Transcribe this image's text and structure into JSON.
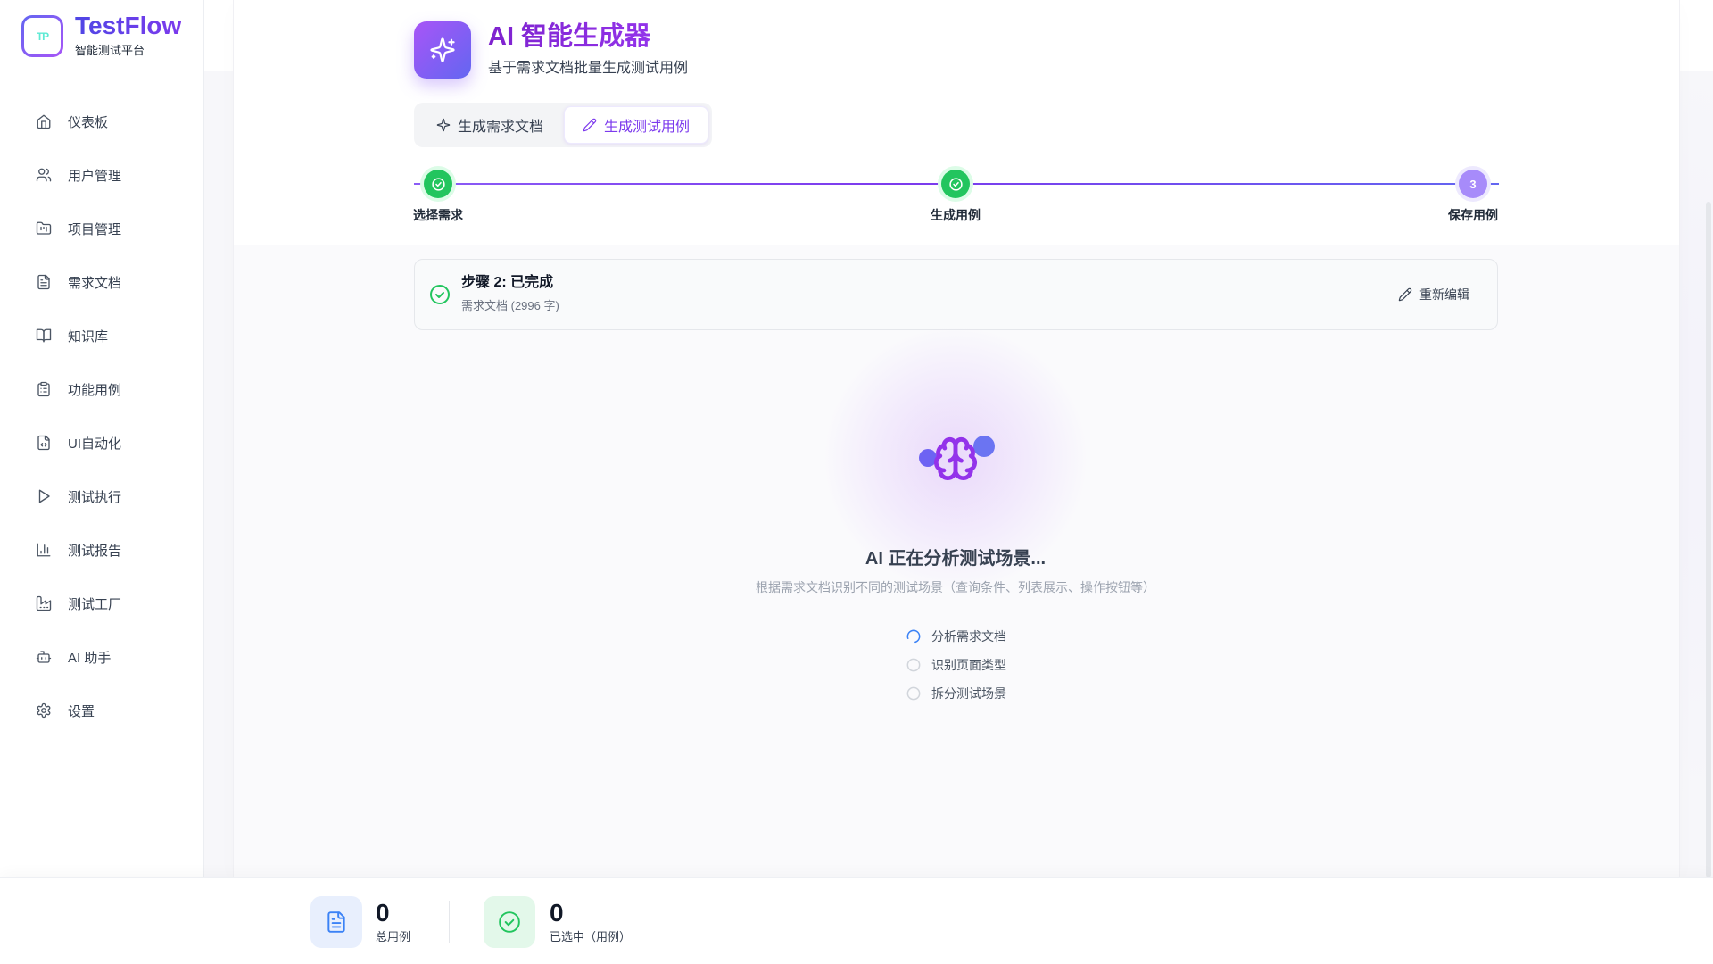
{
  "app": {
    "name": "TestFlow",
    "subtitle": "智能测试平台",
    "logo_text": "TP"
  },
  "sidebar": {
    "items": [
      {
        "label": "仪表板",
        "icon": "home-icon"
      },
      {
        "label": "用户管理",
        "icon": "users-icon"
      },
      {
        "label": "项目管理",
        "icon": "folder-icon"
      },
      {
        "label": "需求文档",
        "icon": "file-text-icon"
      },
      {
        "label": "知识库",
        "icon": "book-open-icon"
      },
      {
        "label": "功能用例",
        "icon": "clipboard-list-icon"
      },
      {
        "label": "UI自动化",
        "icon": "file-code-icon"
      },
      {
        "label": "测试执行",
        "icon": "play-icon"
      },
      {
        "label": "测试报告",
        "icon": "bar-chart-icon"
      },
      {
        "label": "测试工厂",
        "icon": "factory-icon"
      },
      {
        "label": "AI 助手",
        "icon": "bot-icon"
      },
      {
        "label": "设置",
        "icon": "settings-icon"
      }
    ]
  },
  "header": {
    "title": "AI 智能生成器",
    "subtitle": "基于需求文档批量生成测试用例",
    "icon": "sparkles-icon"
  },
  "tabs": [
    {
      "label": "生成需求文档",
      "icon": "sparkles-icon",
      "active": false
    },
    {
      "label": "生成测试用例",
      "icon": "pencil-icon",
      "active": true
    }
  ],
  "stepper": {
    "steps": [
      {
        "label": "选择需求",
        "status": "done"
      },
      {
        "label": "生成用例",
        "status": "done"
      },
      {
        "label": "保存用例",
        "status": "current",
        "number": "3"
      }
    ]
  },
  "step_card": {
    "title": "步骤 2: 已完成",
    "detail": "需求文档 (2996 字)",
    "edit_label": "重新编辑"
  },
  "loading": {
    "title": "AI 正在分析测试场景...",
    "description": "根据需求文档识别不同的测试场景（查询条件、列表展示、操作按钮等）",
    "tasks": [
      {
        "label": "分析需求文档",
        "status": "in-progress"
      },
      {
        "label": "识别页面类型",
        "status": "pending"
      },
      {
        "label": "拆分测试场景",
        "status": "pending"
      }
    ]
  },
  "stats": [
    {
      "value": 0,
      "label": "总用例",
      "icon": "document-icon"
    },
    {
      "value": 0,
      "label": "已选中（用例）",
      "icon": "check-circle-icon"
    }
  ],
  "colors": {
    "accent": "#7c3aed",
    "success": "#22c55e",
    "info": "#3b82f6",
    "muted": "#9ca3af"
  }
}
